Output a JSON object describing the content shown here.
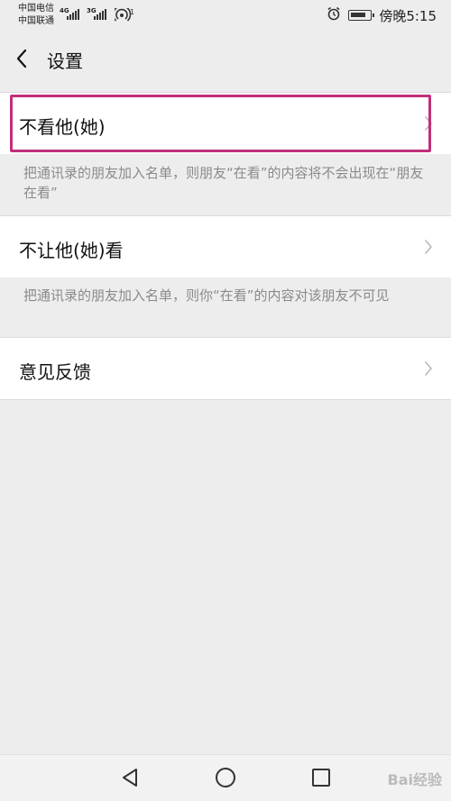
{
  "status_bar": {
    "carrier1": "中国电信",
    "carrier2": "中国联通",
    "net1": "4G",
    "net2": "3G",
    "hotspot_count": "1",
    "time": "傍晚5:15",
    "icons": [
      "signal-icon",
      "hotspot-icon",
      "alarm-icon",
      "battery-icon"
    ]
  },
  "header": {
    "title": "设置",
    "back_icon": "chevron-left-icon"
  },
  "settings": {
    "items": [
      {
        "label": "不看他(她)",
        "note": "把通讯录的朋友加入名单，则朋友“在看”的内容将不会出现在“朋友在看”",
        "selected": true
      },
      {
        "label": "不让他(她)看",
        "note": "把通讯录的朋友加入名单，则你“在看”的内容对该朋友不可见",
        "selected": false
      },
      {
        "label": "意见反馈",
        "note": "",
        "selected": false
      }
    ]
  },
  "navbar": {
    "buttons": [
      "nav-back-icon",
      "nav-home-icon",
      "nav-recents-icon"
    ]
  },
  "watermark": {
    "text": "Bai经验"
  },
  "colors": {
    "background": "#ededed",
    "row_background": "#ffffff",
    "highlight_border": "#c0307a",
    "note_text": "#8a8a8a"
  }
}
